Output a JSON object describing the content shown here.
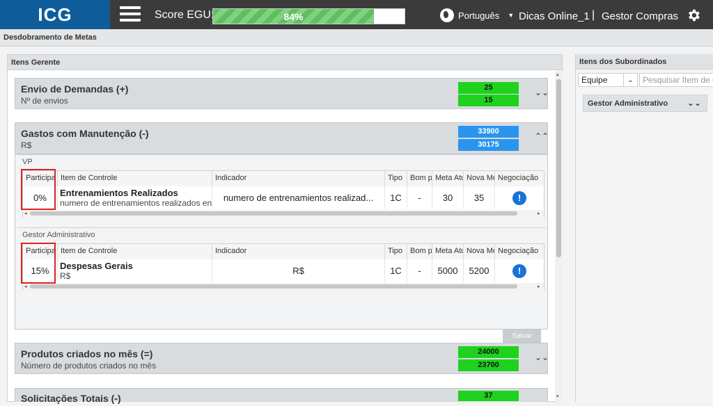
{
  "header": {
    "logo": "ICG",
    "score_label": "Score EGU:",
    "score_percent": 84,
    "score_text": "84%",
    "language": "Português",
    "user": "Dicas Online_1",
    "separator": "|",
    "role": "Gestor Compras",
    "icons": [
      "menu-icon",
      "globe-icon",
      "caret-down-icon",
      "gear-icon"
    ]
  },
  "subheader": {
    "title": "Desdobramento de Metas"
  },
  "left_panel": {
    "title": "Itens Gerente",
    "cards": [
      {
        "title": "Envio de Demandas (+)",
        "sub": "Nº de envios",
        "v1": "25",
        "v2": "15",
        "color": "#1ed21e"
      },
      {
        "title": "Gastos com Manutenção (-)",
        "sub": "R$",
        "v1": "33900",
        "v2": "30175",
        "color": "#2a95ef"
      },
      {
        "title": "Produtos criados no mês (=)",
        "sub": "Número de produtos criados no mês",
        "v1": "24000",
        "v2": "23700",
        "color": "#1ed21e"
      },
      {
        "title": "Solicitações Totais (-)",
        "v1": "37"
      }
    ],
    "columns": [
      "Participa",
      "Item de Controle",
      "Indicador",
      "Tipo",
      "Bom pa",
      "Meta Atu",
      "Nova Me",
      "Negociação"
    ],
    "groups": [
      {
        "label": "VP",
        "row": {
          "participa": "0%",
          "item_title": "Entrenamientos Realizados",
          "item_sub": "numero de entrenamientos realizados en",
          "indicador": "numero de entrenamientos realizad...",
          "tipo": "1C",
          "bom": "-",
          "meta": "30",
          "nova": "35"
        }
      },
      {
        "label": "Gestor Administrativo",
        "row": {
          "participa": "15%",
          "item_title": "Despesas Gerais",
          "item_sub": "R$",
          "indicador": "R$",
          "tipo": "1C",
          "bom": "-",
          "meta": "5000",
          "nova": "5200"
        }
      }
    ],
    "save_label": "Salvar"
  },
  "right_panel": {
    "title": "Itens dos Subordinados",
    "select_value": "Equipe",
    "search_placeholder": "Pesquisar Item de Co",
    "group_label": "Gestor Administrativo"
  }
}
